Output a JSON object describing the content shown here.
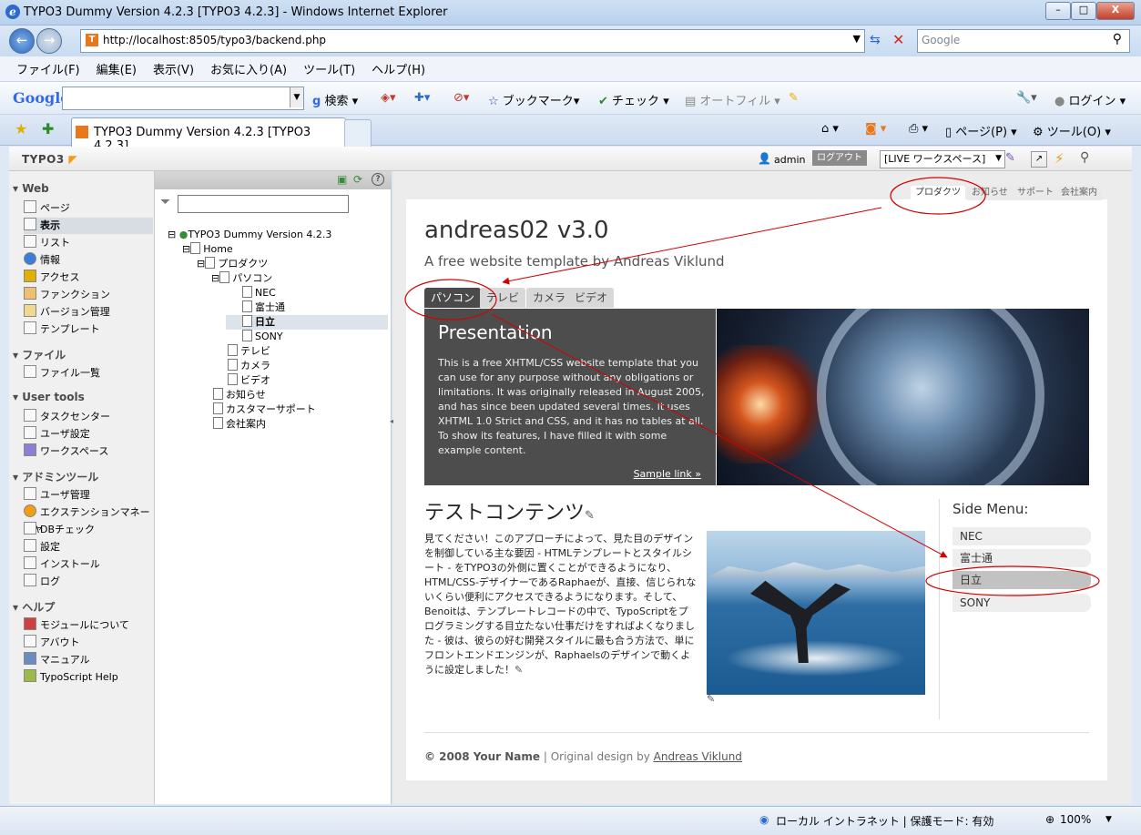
{
  "window": {
    "title": "TYPO3 Dummy Version 4.2.3 [TYPO3 4.2.3] - Windows Internet Explorer",
    "min": "–",
    "max": "□",
    "close": "X"
  },
  "address": {
    "url": "http://localhost:8505/typo3/backend.php",
    "search_placeholder": "Google"
  },
  "menubar": [
    "ファイル(F)",
    "編集(E)",
    "表示(V)",
    "お気に入り(A)",
    "ツール(T)",
    "ヘルプ(H)"
  ],
  "gtoolbar": {
    "logo": "Google",
    "search": "検索",
    "bookmarks": "ブックマーク",
    "check": "チェック",
    "autofill": "オートフィル",
    "login": "ログイン"
  },
  "tabs": {
    "active": "TYPO3 Dummy Version 4.2.3 [TYPO3 4.2.3]",
    "page": "ページ(P)",
    "tools": "ツール(O)"
  },
  "typo3": {
    "logo": "TYPO3",
    "user": "admin",
    "logout": "ログアウト",
    "workspace": "[LIVE ワークスペース]",
    "modules": [
      {
        "head": "Web",
        "items": [
          "ページ",
          "表示",
          "リスト",
          "情報",
          "アクセス",
          "ファンクション",
          "バージョン管理",
          "テンプレート"
        ]
      },
      {
        "head": "ファイル",
        "items": [
          "ファイル一覧"
        ]
      },
      {
        "head": "User tools",
        "items": [
          "タスクセンター",
          "ユーザ設定",
          "ワークスペース"
        ]
      },
      {
        "head": "アドミンツール",
        "items": [
          "ユーザ管理",
          "エクステンションマネージャ",
          "DBチェック",
          "設定",
          "インストール",
          "ログ"
        ]
      },
      {
        "head": "ヘルプ",
        "items": [
          "モジュールについて",
          "アバウト",
          "マニュアル",
          "TypoScript Help"
        ]
      }
    ],
    "tree": {
      "root": "TYPO3 Dummy Version 4.2.3",
      "home": "Home",
      "products": "プロダクツ",
      "pc": "パソコン",
      "nec": "NEC",
      "fujitsu": "富士通",
      "hitachi": "日立",
      "sony": "SONY",
      "tv": "テレビ",
      "camera": "カメラ",
      "video": "ビデオ",
      "news": "お知らせ",
      "support": "カスタマーサポート",
      "company": "会社案内"
    }
  },
  "site": {
    "topnav": [
      "プロダクツ",
      "お知らせ",
      "サポート",
      "会社案内"
    ],
    "title": "andreas02 v3.0",
    "slogan": "A free website template by Andreas Viklund",
    "tabs": [
      "パソコン",
      "テレビ",
      "カメラ",
      "ビデオ"
    ],
    "presentation": {
      "heading": "Presentation",
      "text": "This is a free XHTML/CSS website template that you can use for any purpose without any obligations or limitations. It was originally released in August 2005, and has since been updated several times. It uses XHTML 1.0 Strict and CSS, and it has no tables at all. To show its features, I have filled it with some example content.",
      "link": "Sample link »"
    },
    "content_title": "テストコンテンツ",
    "content_text": "見てください！このアプローチによって、見た目のデザインを制御している主な要因 - HTMLテンプレートとスタイルシート - をTYPO3の外側に置くことができるようになり、HTML/CSS-デザイナーであるRaphaeが、直接、信じられないくらい便利にアクセスできるようになります。そして、Benoitは、テンプレートレコードの中で、TypoScriptをプログラミングする目立たない仕事だけをすればよくなりました - 彼は、彼らの好む開発スタイルに最も合う方法で、単にフロントエンドエンジンが、Raphaelsのデザインで動くように設定しました！",
    "side_menu_title": "Side Menu:",
    "side_menu": [
      "NEC",
      "富士通",
      "日立",
      "SONY"
    ],
    "footer_copy": "© 2008 Your Name",
    "footer_sep": " | Original design by ",
    "footer_author": "Andreas Viklund"
  },
  "status": {
    "zone": "ローカル イントラネット | 保護モード: 有効",
    "zoom": "100%"
  },
  "colors": {
    "annotation": "#d40000",
    "typo3_orange": "#f39c12"
  }
}
